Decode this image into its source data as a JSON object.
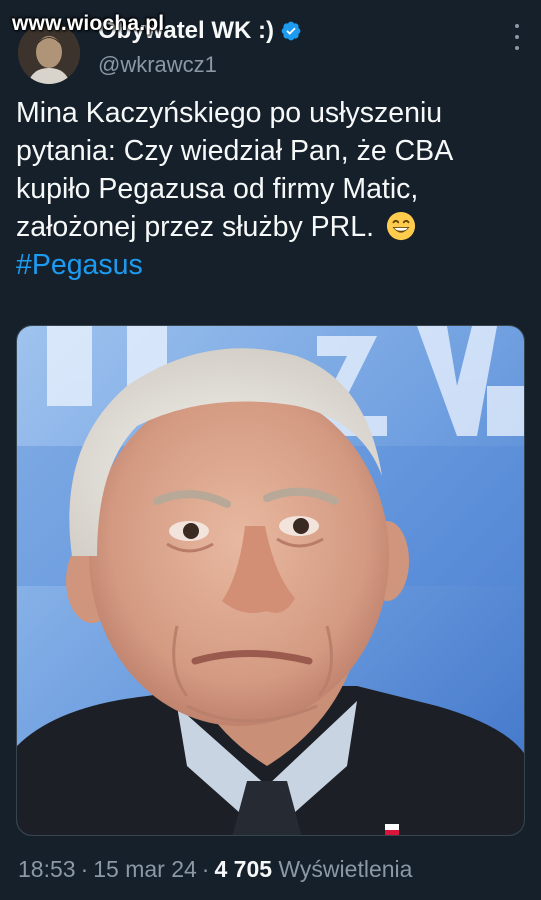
{
  "watermark": "www.wiocha.pl",
  "author": {
    "display_name": "Obywatel WK :)",
    "handle": "@wkrawcz1",
    "verified": true
  },
  "tweet": {
    "lines": [
      "Mina Kaczyńskiego po usłyszeniu",
      "pytania: Czy wiedział Pan, że CBA",
      "kupiło Pegazusa od firmy Matic,",
      "założonej przez służby PRL."
    ],
    "emoji": "grinning-face-with-smiling-eyes",
    "hashtag": "#Pegasus"
  },
  "meta": {
    "time": "18:53",
    "separator": "·",
    "date": "15 mar 24",
    "views_count": "4 705",
    "views_label": "Wyświetlenia"
  },
  "colors": {
    "background": "#15202b",
    "text": "#f7f9f9",
    "secondary": "#8b98a5",
    "accent": "#1d9bf0"
  },
  "icons": {
    "verified": "verified-badge-icon",
    "more": "more-options-icon"
  }
}
